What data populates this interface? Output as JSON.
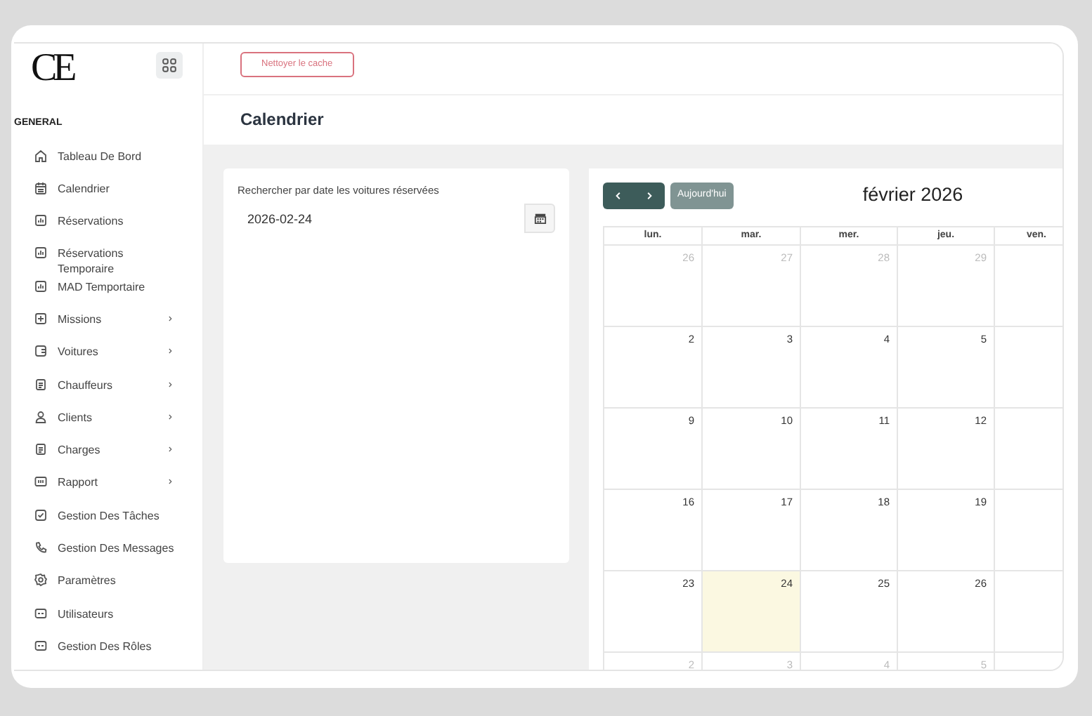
{
  "sidebar": {
    "logo": "CE",
    "section_title": "GENERAL",
    "items": [
      {
        "label": "Tableau De Bord",
        "expandable": false
      },
      {
        "label": "Calendrier",
        "expandable": false
      },
      {
        "label": "Réservations",
        "expandable": false
      },
      {
        "label": "Réservations Temporaire",
        "expandable": false
      },
      {
        "label": "MAD Temportaire",
        "expandable": false
      },
      {
        "label": "Missions",
        "expandable": true
      },
      {
        "label": "Voitures",
        "expandable": true
      },
      {
        "label": "Chauffeurs",
        "expandable": true
      },
      {
        "label": "Clients",
        "expandable": true
      },
      {
        "label": "Charges",
        "expandable": true
      },
      {
        "label": "Rapport",
        "expandable": true
      },
      {
        "label": "Gestion Des Tâches",
        "expandable": false
      },
      {
        "label": "Gestion Des Messages",
        "expandable": false
      },
      {
        "label": "Paramètres",
        "expandable": false
      },
      {
        "label": "Utilisateurs",
        "expandable": false
      },
      {
        "label": "Gestion Des Rôles",
        "expandable": false
      }
    ]
  },
  "topbar": {
    "clear_cache_button": "Nettoyer le cache"
  },
  "page_title": "Calendrier",
  "search": {
    "label": "Rechercher par date les voitures réservées",
    "value": "2026-02-24"
  },
  "calendar": {
    "today_button": {
      "label": "Aujourd'hui",
      "disabled": true
    },
    "month_title": "février 2026",
    "weekdays": [
      "lun.",
      "mar.",
      "mer.",
      "jeu.",
      "ven."
    ],
    "weeks": [
      [
        {
          "day": "26",
          "other_month": true,
          "today": false
        },
        {
          "day": "27",
          "other_month": true,
          "today": false
        },
        {
          "day": "28",
          "other_month": true,
          "today": false
        },
        {
          "day": "29",
          "other_month": true,
          "today": false
        }
      ],
      [
        {
          "day": "2",
          "other_month": false,
          "today": false
        },
        {
          "day": "3",
          "other_month": false,
          "today": false
        },
        {
          "day": "4",
          "other_month": false,
          "today": false
        },
        {
          "day": "5",
          "other_month": false,
          "today": false
        }
      ],
      [
        {
          "day": "9",
          "other_month": false,
          "today": false
        },
        {
          "day": "10",
          "other_month": false,
          "today": false
        },
        {
          "day": "11",
          "other_month": false,
          "today": false
        },
        {
          "day": "12",
          "other_month": false,
          "today": false
        }
      ],
      [
        {
          "day": "16",
          "other_month": false,
          "today": false
        },
        {
          "day": "17",
          "other_month": false,
          "today": false
        },
        {
          "day": "18",
          "other_month": false,
          "today": false
        },
        {
          "day": "19",
          "other_month": false,
          "today": false
        }
      ],
      [
        {
          "day": "23",
          "other_month": false,
          "today": false
        },
        {
          "day": "24",
          "other_month": false,
          "today": true
        },
        {
          "day": "25",
          "other_month": false,
          "today": false
        },
        {
          "day": "26",
          "other_month": false,
          "today": false
        }
      ],
      [
        {
          "day": "2",
          "other_month": true,
          "today": false
        },
        {
          "day": "3",
          "other_month": true,
          "today": false
        },
        {
          "day": "4",
          "other_month": true,
          "today": false
        },
        {
          "day": "5",
          "other_month": true,
          "today": false
        }
      ]
    ]
  }
}
